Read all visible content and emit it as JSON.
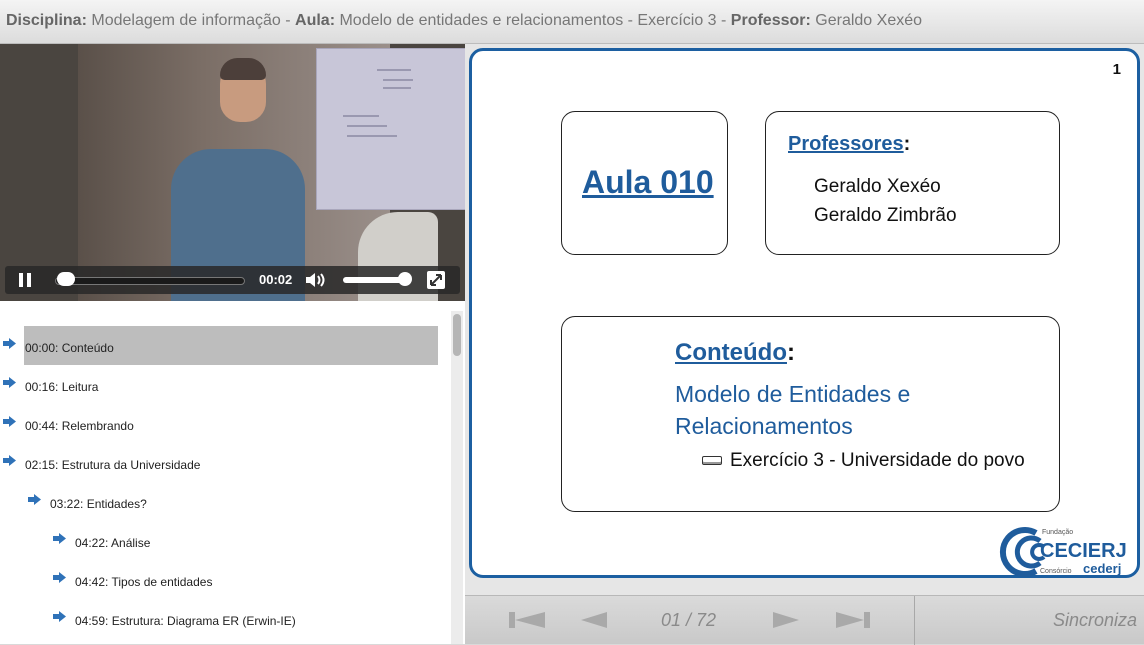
{
  "header": {
    "disciplina_label": "Disciplina:",
    "disciplina": "Modelagem de informação",
    "aula_label": "Aula:",
    "aula": "Modelo de entidades e relacionamentos - Exercício 3",
    "professor_label": "Professor:",
    "professor": "Geraldo Xexéo",
    "sep": " - "
  },
  "player": {
    "time": "00:02",
    "progress": 0.02,
    "volume": 0.9
  },
  "chapters": [
    {
      "label": "00:00: Conteúdo",
      "indent": 0,
      "selected": true
    },
    {
      "label": "00:16: Leitura",
      "indent": 0
    },
    {
      "label": "00:44: Relembrando",
      "indent": 0
    },
    {
      "label": "02:15: Estrutura da Universidade",
      "indent": 0
    },
    {
      "label": "03:22: Entidades?",
      "indent": 1
    },
    {
      "label": "04:22: Análise",
      "indent": 2
    },
    {
      "label": "04:42: Tipos de entidades",
      "indent": 2
    },
    {
      "label": "04:59: Estrutura: Diagrama ER (Erwin-IE)",
      "indent": 2
    }
  ],
  "slide": {
    "number": "1",
    "aula_title": "Aula 010",
    "professores_label": "Professores",
    "colon": ":",
    "professores": [
      "Geraldo Xexéo",
      "Geraldo Zimbrão"
    ],
    "conteudo_label": "Conteúdo",
    "conteudo_lines": [
      "Modelo de Entidades e",
      "Relacionamentos"
    ],
    "conteudo_sub": "Exercício 3 - Universidade do povo",
    "logo_top": "Fundação",
    "logo_main": "CECIERJ",
    "logo_consorcio": "Consórcio",
    "logo_cederj": "cederj"
  },
  "nav": {
    "page": "01 / 72",
    "sync": "Sincroniza"
  },
  "colors": {
    "accent_blue": "#1f5c9c",
    "arrow_blue": "#2f72b8",
    "selected_row": "#bdbdbd"
  }
}
